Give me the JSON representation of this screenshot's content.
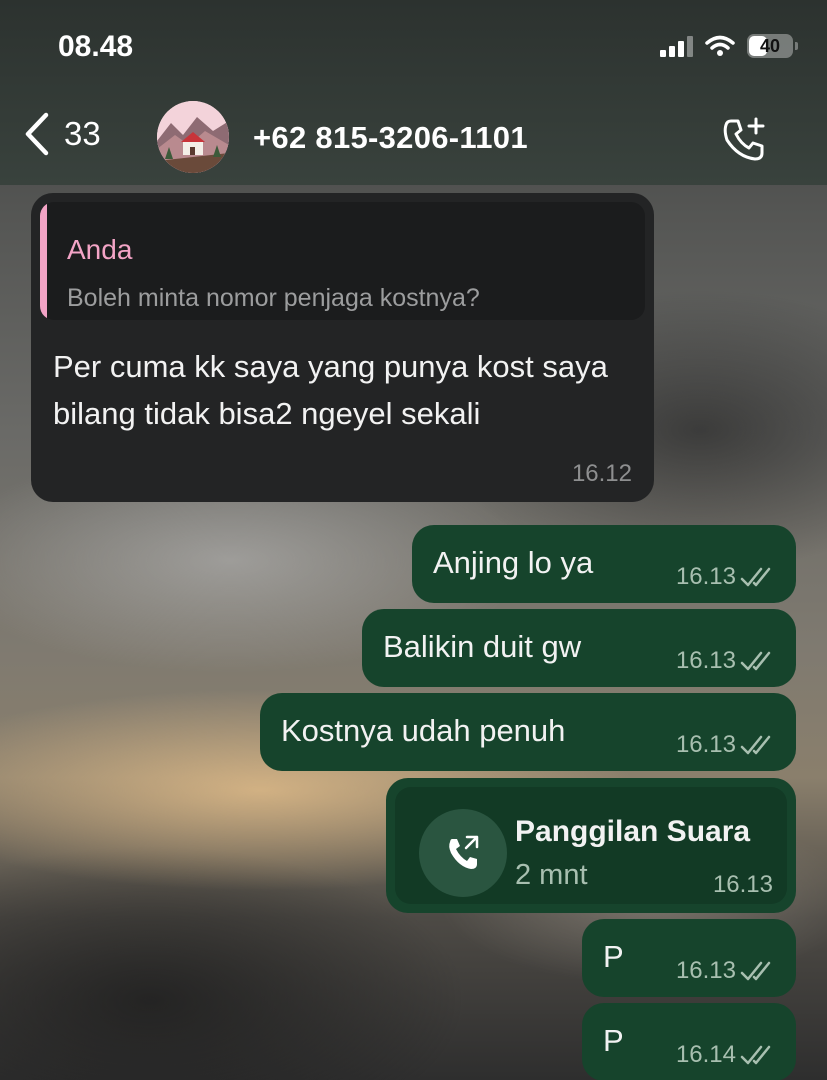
{
  "status_bar": {
    "time": "08.48",
    "battery": "40"
  },
  "header": {
    "back_count": "33",
    "contact_name": "+62 815-3206-1101",
    "icons": [
      "chevron-left-icon",
      "avatar",
      "add-call-icon"
    ]
  },
  "messages": {
    "incoming": {
      "quote_author": "Anda",
      "quote_text": "Boleh minta nomor penjaga kostnya?",
      "text": "Per cuma kk saya yang punya kost saya bilang tidak bisa2 ngeyel sekali",
      "time": "16.12"
    },
    "outgoing": [
      {
        "text": "Anjing lo ya",
        "time": "16.13"
      },
      {
        "text": "Balikin duit gw",
        "time": "16.13"
      },
      {
        "text": "Kostnya udah penuh",
        "time": "16.13"
      }
    ],
    "call": {
      "title": "Panggilan Suara",
      "duration": "2 mnt",
      "time": "16.13"
    },
    "outgoing_after": [
      {
        "text": "P",
        "time": "16.13"
      },
      {
        "text": "P",
        "time": "16.14"
      }
    ]
  },
  "colors": {
    "header_bg": "#39423d",
    "incoming_bubble": "#232425",
    "outgoing_bubble": "#16442c",
    "quote_accent": "#f3a4c6"
  }
}
